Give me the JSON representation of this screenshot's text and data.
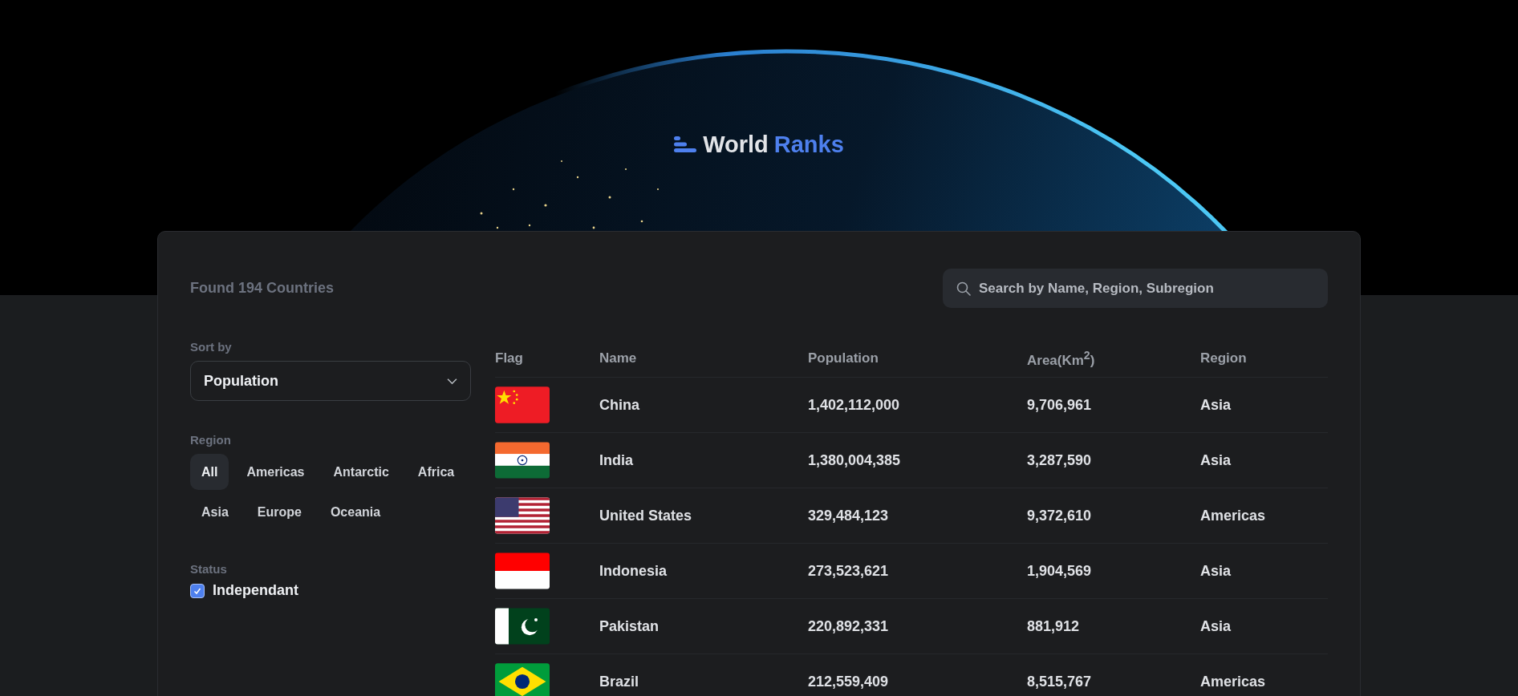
{
  "logo": {
    "word_1": "World",
    "word_2": "Ranks"
  },
  "summary": "Found 194 Countries",
  "search": {
    "placeholder": "Search by Name, Region, Subregion"
  },
  "sort": {
    "label": "Sort by",
    "value": "Population"
  },
  "region_filter": {
    "label": "Region",
    "options": [
      {
        "label": "All",
        "selected": true
      },
      {
        "label": "Americas",
        "selected": false
      },
      {
        "label": "Antarctic",
        "selected": false
      },
      {
        "label": "Africa",
        "selected": false
      },
      {
        "label": "Asia",
        "selected": false
      },
      {
        "label": "Europe",
        "selected": false
      },
      {
        "label": "Oceania",
        "selected": false
      }
    ]
  },
  "status_filter": {
    "label": "Status",
    "options": [
      {
        "label": "Independant",
        "checked": true
      }
    ]
  },
  "table": {
    "columns": [
      "Flag",
      "Name",
      "Population",
      "Area(Km$^{2}$)",
      "Region"
    ],
    "rows": [
      {
        "flag": {
          "kind": "china"
        },
        "name": "China",
        "population": "1,402,112,000",
        "area": "9,706,961",
        "region": "Asia"
      },
      {
        "flag": {
          "kind": "india"
        },
        "name": "India",
        "population": "1,380,004,385",
        "area": "3,287,590",
        "region": "Asia"
      },
      {
        "flag": {
          "kind": "usa"
        },
        "name": "United States",
        "population": "329,484,123",
        "area": "9,372,610",
        "region": "Americas"
      },
      {
        "flag": {
          "kind": "indonesia"
        },
        "name": "Indonesia",
        "population": "273,523,621",
        "area": "1,904,569",
        "region": "Asia"
      },
      {
        "flag": {
          "kind": "pakistan"
        },
        "name": "Pakistan",
        "population": "220,892,331",
        "area": "881,912",
        "region": "Asia"
      },
      {
        "flag": {
          "kind": "brazil"
        },
        "name": "Brazil",
        "population": "212,559,409",
        "area": "8,515,767",
        "region": "Americas"
      }
    ]
  }
}
